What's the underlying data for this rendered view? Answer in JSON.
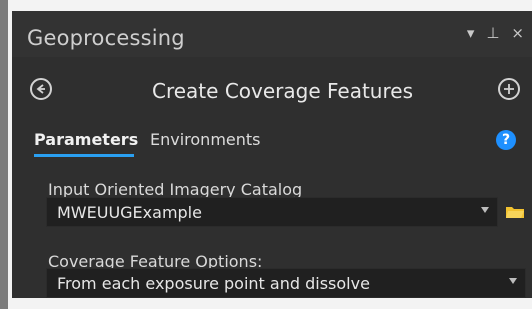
{
  "panel": {
    "title": "Geoprocessing",
    "controls": {
      "pin": "▾",
      "float": "⊥",
      "close": "×"
    },
    "tool_title": "Create Coverage Features",
    "back_icon": "back-arrow-icon",
    "add_icon": "plus-icon",
    "help_icon": "question-icon"
  },
  "tabs": [
    {
      "label": "Parameters",
      "active": true
    },
    {
      "label": "Environments",
      "active": false
    }
  ],
  "fields": {
    "input_label": "Input Oriented Imagery Catalog",
    "input_value": "MWEUUGExample",
    "option_label": "Coverage Feature Options:",
    "option_value": "From each exposure point and dissolve"
  },
  "colors": {
    "accent": "#2aa0f2",
    "folder": "#f2c230"
  }
}
